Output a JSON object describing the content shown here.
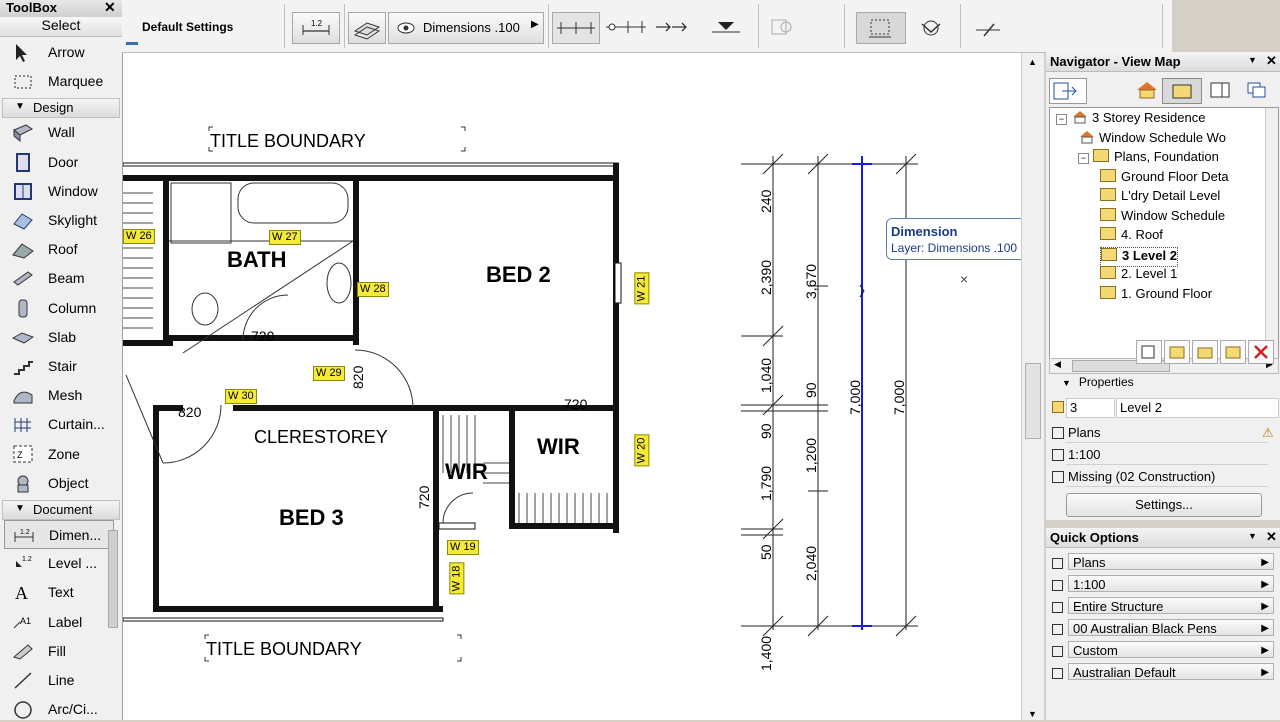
{
  "toolbox": {
    "title": "ToolBox",
    "close": "✕",
    "select_label": "Select",
    "select_items": [
      {
        "label": "Arrow",
        "icon": "arrow-icon"
      },
      {
        "label": "Marquee",
        "icon": "marquee-icon"
      }
    ],
    "design_label": "Design",
    "design_items": [
      {
        "label": "Wall",
        "icon": "wall-icon"
      },
      {
        "label": "Door",
        "icon": "door-icon"
      },
      {
        "label": "Window",
        "icon": "window-icon"
      },
      {
        "label": "Skylight",
        "icon": "skylight-icon"
      },
      {
        "label": "Roof",
        "icon": "roof-icon"
      },
      {
        "label": "Beam",
        "icon": "beam-icon"
      },
      {
        "label": "Column",
        "icon": "column-icon"
      },
      {
        "label": "Slab",
        "icon": "slab-icon"
      },
      {
        "label": "Stair",
        "icon": "stair-icon"
      },
      {
        "label": "Mesh",
        "icon": "mesh-icon"
      },
      {
        "label": "Curtain...",
        "icon": "curtain-wall-icon"
      },
      {
        "label": "Zone",
        "icon": "zone-icon"
      },
      {
        "label": "Object",
        "icon": "object-icon"
      }
    ],
    "document_label": "Document",
    "document_items": [
      {
        "label": "Dimen...",
        "icon": "dimension-icon"
      },
      {
        "label": "Level ...",
        "icon": "level-dimension-icon"
      },
      {
        "label": "Text",
        "icon": "text-icon"
      },
      {
        "label": "Label",
        "icon": "label-icon"
      },
      {
        "label": "Fill",
        "icon": "fill-icon"
      },
      {
        "label": "Line",
        "icon": "line-icon"
      },
      {
        "label": "Arc/Ci...",
        "icon": "arc-circle-icon"
      }
    ]
  },
  "infobox": {
    "settings_label": "Default Settings",
    "layer_label": "Dimensions .100"
  },
  "drawing": {
    "rooms": [
      "BATH",
      "BED 2",
      "CLERESTOREY",
      "WIR",
      "WIR",
      "BED 3"
    ],
    "title_boundary_top": "TITLE BOUNDARY",
    "title_boundary_bottom": "TITLE BOUNDARY",
    "window_tags": [
      "W 26",
      "W 27",
      "W 28",
      "W 29",
      "W 30",
      "W 21",
      "W 20",
      "W 19",
      "W 18"
    ],
    "door_dims": [
      "720",
      "820",
      "820",
      "720",
      "720"
    ],
    "dims_col1": [
      "240",
      "2,390",
      "1,040",
      "90",
      "1,790",
      "50",
      "1,400"
    ],
    "dims_col2": [
      "3,670",
      "90",
      "1,200",
      "2,040"
    ],
    "dims_col3": "7,000",
    "dims_col4": "7,000",
    "tooltip_title": "Dimension",
    "tooltip_layer": "Layer: Dimensions .100"
  },
  "navigator": {
    "title": "Navigator - View Map",
    "tree": [
      "3 Storey Residence",
      "Window Schedule Wo",
      "Plans, Foundation",
      "Ground Floor Deta",
      "L'dry Detail Level",
      "Window Schedule",
      "4. Roof",
      "3 Level 2",
      "2. Level 1",
      "1. Ground Floor"
    ],
    "properties_label": "Properties",
    "prop_id": "3",
    "prop_name": "Level 2",
    "prop_layer_combo": "Plans",
    "prop_scale": "1:100",
    "prop_pen": "Missing (02 Construction)",
    "settings_button": "Settings..."
  },
  "quick_options": {
    "title": "Quick Options",
    "options": [
      "Plans",
      "1:100",
      "Entire Structure",
      "00 Australian Black Pens",
      "Custom",
      "Australian Default"
    ]
  },
  "colors": {
    "tag_yellow": "#f5ea3a",
    "dim_blue": "#1a1ae0",
    "tooltip_text": "#1a3a8a"
  }
}
